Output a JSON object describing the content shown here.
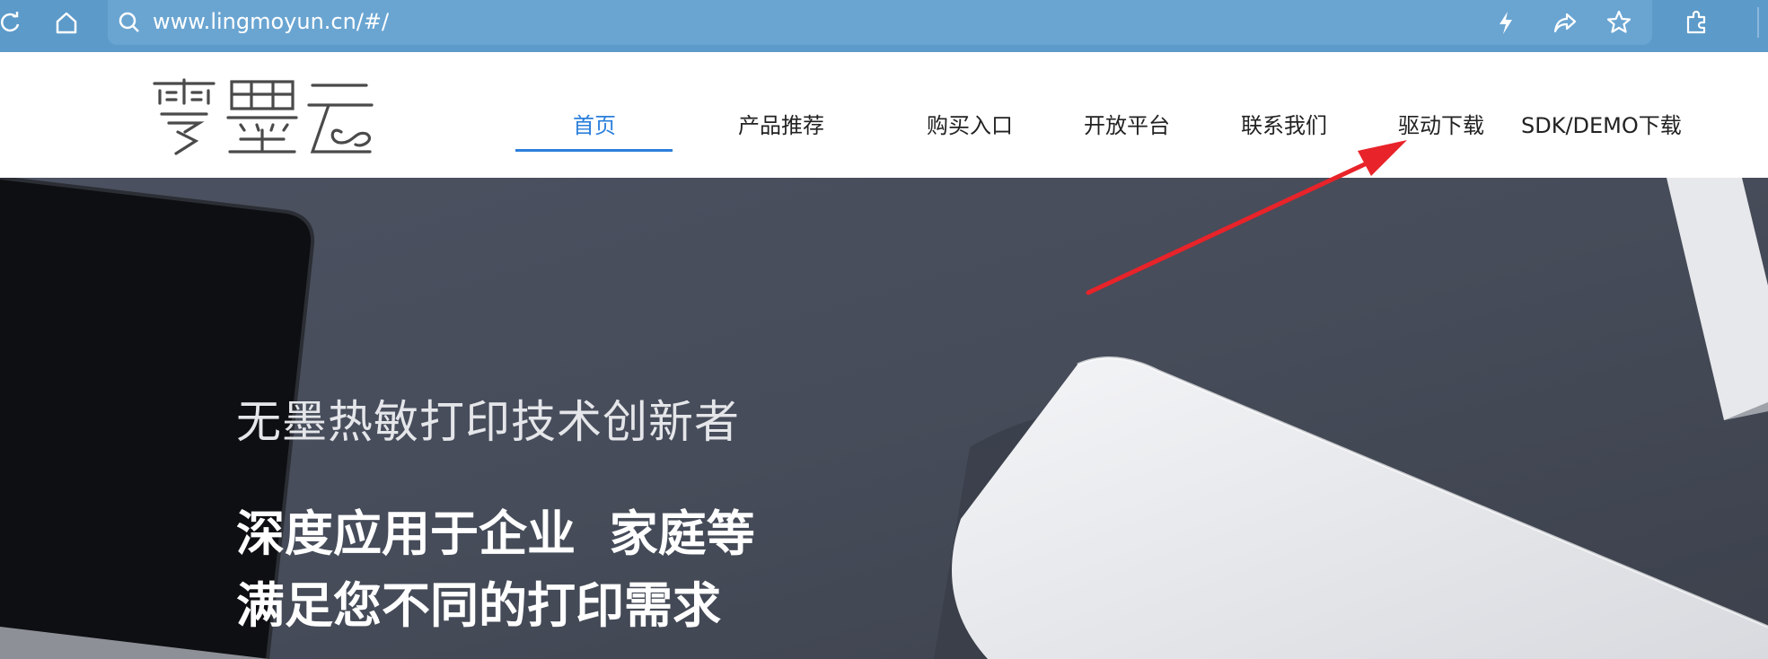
{
  "browser": {
    "url": "www.lingmoyun.cn/#/",
    "icons": [
      "refresh-icon",
      "home-icon",
      "search-icon",
      "lightning-icon",
      "share-icon",
      "star-icon",
      "extension-icon"
    ]
  },
  "header": {
    "logo_text": "零墨云",
    "nav": [
      {
        "label": "首页",
        "active": true
      },
      {
        "label": "产品推荐"
      },
      {
        "label": "购买入口"
      },
      {
        "label": "开放平台"
      },
      {
        "label": "联系我们"
      },
      {
        "label": "驱动下载"
      },
      {
        "label": "SDK/DEMO下载"
      }
    ],
    "accent_color": "#2b7fdc"
  },
  "hero": {
    "subtitle": "无墨热敏打印技术创新者",
    "line1": "深度应用于企业  家庭等",
    "line2": "满足您不同的打印需求"
  },
  "annotation": {
    "arrow_color": "#e8232a"
  }
}
